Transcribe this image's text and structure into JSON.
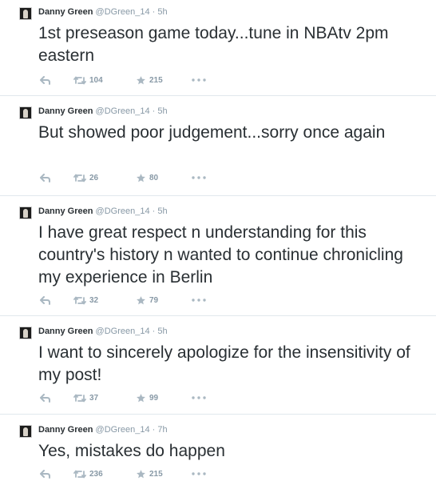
{
  "tweets": [
    {
      "name": "Danny Green",
      "handle": "@DGreen_14",
      "sep": "·",
      "time": "5h",
      "text": "1st preseason game today...tune in NBAtv 2pm eastern",
      "retweets": "104",
      "favorites": "215"
    },
    {
      "name": "Danny Green",
      "handle": "@DGreen_14",
      "sep": "·",
      "time": "5h",
      "text": "But showed poor judgement...sorry once again",
      "retweets": "26",
      "favorites": "80"
    },
    {
      "name": "Danny Green",
      "handle": "@DGreen_14",
      "sep": "·",
      "time": "5h",
      "text": "I have great respect n understanding for this country's history n wanted to continue chronicling my experience in Berlin",
      "retweets": "32",
      "favorites": "79"
    },
    {
      "name": "Danny Green",
      "handle": "@DGreen_14",
      "sep": "·",
      "time": "5h",
      "text": "I want to sincerely apologize for the insensitivity of my post!",
      "retweets": "37",
      "favorites": "99"
    },
    {
      "name": "Danny Green",
      "handle": "@DGreen_14",
      "sep": "·",
      "time": "7h",
      "text": "Yes, mistakes do happen",
      "retweets": "236",
      "favorites": "215"
    }
  ],
  "icons": {
    "reply": "reply-icon",
    "retweet": "retweet-icon",
    "favorite": "star-icon",
    "more": "more-icon"
  },
  "colors": {
    "text": "#292f33",
    "meta": "#8899a6",
    "icon": "#aab8c2",
    "divider": "#e1e8ed"
  }
}
